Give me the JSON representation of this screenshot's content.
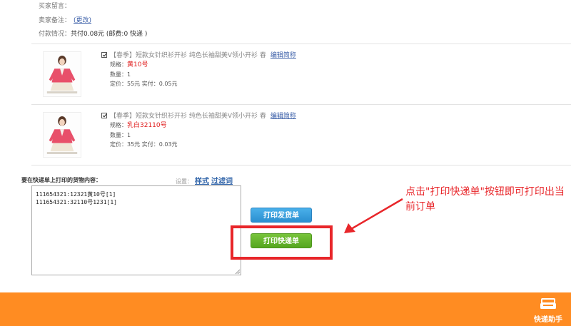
{
  "order": {
    "buyer_message_label": "买家留言：",
    "seller_note_label": "卖家备注：",
    "seller_note_link": "(更改)",
    "payment_label": "付款情况：",
    "payment_value": "共付0.08元 (邮费:0 快递 )"
  },
  "items": [
    {
      "title": "【春季】短款女针织衫开衫 纯色长袖甜美V领小开衫 春",
      "edit_label": "编辑简称",
      "spec_label": "规格：",
      "spec_value": "黄10号",
      "qty_label": "数量：",
      "qty_value": "1",
      "price_text": "定价：55元   实付：0.05元"
    },
    {
      "title": "【春季】短款女针织衫开衫 纯色长袖甜美V领小开衫 春",
      "edit_label": "编辑简称",
      "spec_label": "规格：",
      "spec_value": "乳白32110号",
      "qty_label": "数量：",
      "qty_value": "1",
      "price_text": "定价：35元   实付：0.03元"
    }
  ],
  "print_area": {
    "label": "要在快递单上打印的货物内容：",
    "settings_label": "设置：",
    "style_link": "样式",
    "filter_link": "过滤词",
    "content": "111654321:12321黄10号[1]\n111654321:32110号1231[1]"
  },
  "buttons": {
    "print_invoice": "打印发货单",
    "print_express": "打印快递单"
  },
  "annotation": "点击\"打印快递单\"按钮即可打印出当前订单",
  "footer": {
    "brand": "快递助手"
  },
  "colors": {
    "highlight": "#e8262a",
    "footer": "#ff8c22",
    "blue_button": "#2b8fd0",
    "green_button": "#55a620"
  }
}
